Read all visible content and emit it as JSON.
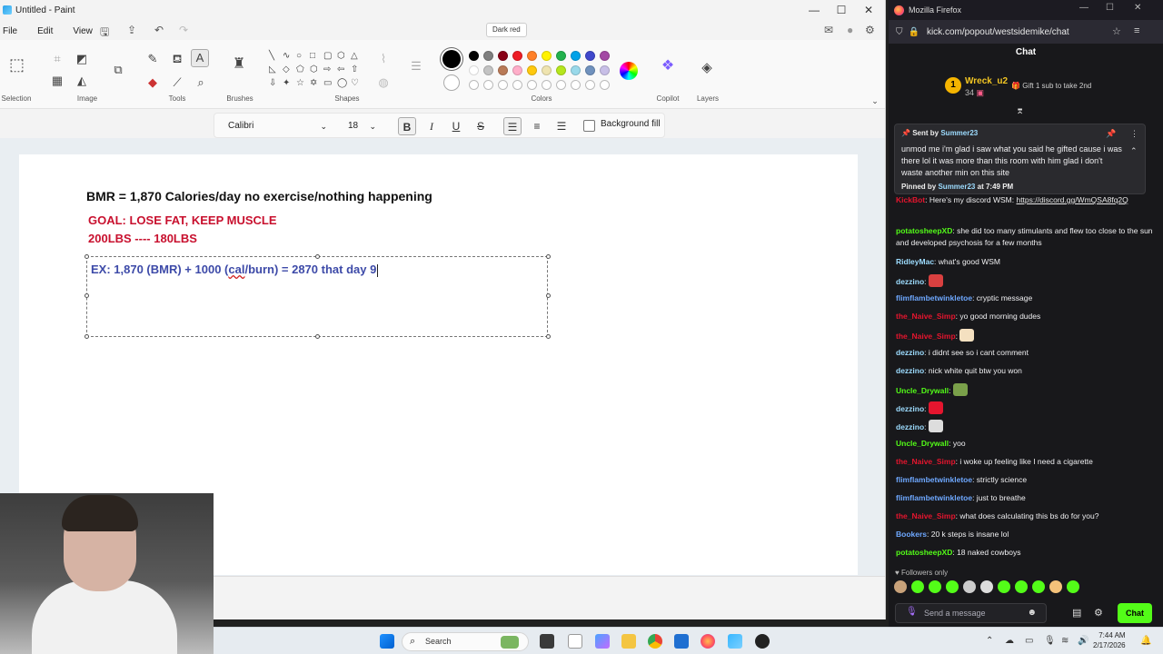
{
  "paint": {
    "title": "Untitled - Paint",
    "menu": [
      "File",
      "Edit",
      "View"
    ],
    "tooltip": "Dark red",
    "groups": {
      "selection": "Selection",
      "image": "Image",
      "tools": "Tools",
      "brushes": "Brushes",
      "shapes": "Shapes",
      "colors": "Colors",
      "copilot": "Copilot",
      "layers": "Layers"
    },
    "palette_row1": [
      "#000000",
      "#7f7f7f",
      "#880015",
      "#ed1c24",
      "#ff7f27",
      "#fff200",
      "#22b14c",
      "#00a2e8",
      "#3f48cc",
      "#a349a4"
    ],
    "palette_row2": [
      "#ffffff",
      "#c3c3c3",
      "#b97a57",
      "#ffaec9",
      "#ffc90e",
      "#efe4b0",
      "#b5e61d",
      "#99d9ea",
      "#7092be",
      "#c8bfe7"
    ],
    "textbar": {
      "font": "Calibri",
      "size": "18",
      "background_fill": "Background fill"
    },
    "canvas": {
      "bmr": "BMR = 1,870 Calories/day no exercise/nothing happening",
      "goal": "GOAL: LOSE FAT, KEEP MUSCLE",
      "weights": "200LBS ---- 180LBS",
      "ex_before": "EX: 1,870 (BMR) + 1000 (",
      "ex_squiggle": "cal",
      "ex_after": "/burn) = 2870 that day 9"
    },
    "colors": {
      "goal_red": "#c8102e",
      "ex_blue": "#3d4aa8"
    }
  },
  "firefox": {
    "title": "Mozilla Firefox",
    "url": "kick.com/popout/westsidemike/chat",
    "chat_header": "Chat",
    "leader": {
      "rank": "1",
      "name": "Wreck_u2",
      "count": "34",
      "cta": "Gift 1 sub to take 2nd"
    },
    "pinned": {
      "sent_by_label": "Sent by",
      "sent_by_user": "Summer23",
      "message": "unmod me i'm glad i saw what you said he gifted cause i was there lol it was more than this room with him glad i don't waste another min on this site",
      "pinned_by_label": "Pinned by",
      "pinned_by_user": "Summer23",
      "pinned_time": "at 7:49 PM"
    },
    "messages": [
      {
        "user": "KickBot",
        "color": "#e5152e",
        "text": ": Here's my discord WSM: ",
        "link": "https://discord.gg/WmQSA8fq2Q"
      },
      {
        "user": "potatosheepXD",
        "color": "#53fc18",
        "text": ": she did too many stimulants and flew too close to the sun and developed psychosis for a few months"
      },
      {
        "user": "RidleyMac",
        "color": "#9ddcff",
        "text": ": what's good WSM"
      },
      {
        "user": "dezzino",
        "color": "#9ddcff",
        "text": ":"
      },
      {
        "user": "flimflambetwinkletoe",
        "color": "#6ea8ff",
        "text": ": cryptic message"
      },
      {
        "user": "the_Naive_Simp",
        "color": "#e5152e",
        "text": ": yo good morning dudes"
      },
      {
        "user": "the_Naive_Simp",
        "color": "#e5152e",
        "text": ":"
      },
      {
        "user": "dezzino",
        "color": "#9ddcff",
        "text": ": i didnt see so i cant comment"
      },
      {
        "user": "dezzino",
        "color": "#9ddcff",
        "text": ": nick white quit btw you won"
      },
      {
        "user": "Uncle_Drywall",
        "color": "#53fc18",
        "text": ":"
      },
      {
        "user": "dezzino",
        "color": "#9ddcff",
        "text": ":"
      },
      {
        "user": "dezzino",
        "color": "#9ddcff",
        "text": ":"
      },
      {
        "user": "Uncle_Drywall",
        "color": "#53fc18",
        "text": ": yoo"
      },
      {
        "user": "the_Naive_Simp",
        "color": "#e5152e",
        "text": ": i woke up feeling like I need a cigarette"
      },
      {
        "user": "flimflambetwinkletoe",
        "color": "#6ea8ff",
        "text": ": strictly science"
      },
      {
        "user": "flimflambetwinkletoe",
        "color": "#6ea8ff",
        "text": ": just to breathe"
      },
      {
        "user": "the_Naive_Simp",
        "color": "#e5152e",
        "text": ": what does calculating this bs do for you?"
      },
      {
        "user": "Bookers",
        "color": "#6ea8ff",
        "text": ": 20 k steps is insane lol"
      },
      {
        "user": "potatosheepXD",
        "color": "#53fc18",
        "text": ": 18 naked cowboys"
      }
    ],
    "followers_only": "Followers only",
    "input_placeholder": "Send a message",
    "chat_button": "Chat",
    "accent": "#53fc18"
  },
  "taskbar": {
    "search": "Search",
    "time": "7:44 AM",
    "date": "2/17/2026"
  }
}
